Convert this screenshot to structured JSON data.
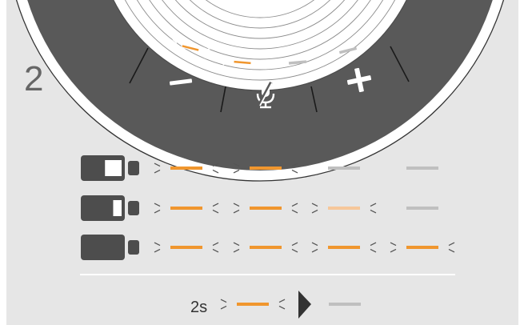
{
  "step_number": "2",
  "buttons": [
    {
      "name": "volume-down",
      "icon": "minus-icon"
    },
    {
      "name": "mute",
      "icon": "microphone-muted-icon"
    },
    {
      "name": "volume-up",
      "icon": "plus-icon"
    }
  ],
  "device_leds": [
    {
      "state": "blinking",
      "color": "#F0962E"
    },
    {
      "state": "blinking",
      "color": "#F0962E"
    },
    {
      "state": "off",
      "color": "#BFBFBF"
    },
    {
      "state": "off",
      "color": "#BFBFBF"
    }
  ],
  "battery_rows": [
    {
      "battery_icon": "battery-low-icon",
      "level": 0.33,
      "leds": [
        {
          "state": "blinking",
          "color": "#F0962E"
        },
        {
          "state": "blinking",
          "color": "#F0962E"
        },
        {
          "state": "off",
          "color": "#BFBFBF"
        },
        {
          "state": "off",
          "color": "#BFBFBF"
        }
      ]
    },
    {
      "battery_icon": "battery-medium-icon",
      "level": 0.66,
      "leds": [
        {
          "state": "blinking",
          "color": "#F0962E"
        },
        {
          "state": "blinking",
          "color": "#F0962E"
        },
        {
          "state": "blinking",
          "color": "#F6C79A"
        },
        {
          "state": "off",
          "color": "#BFBFBF"
        }
      ]
    },
    {
      "battery_icon": "battery-full-icon",
      "level": 1.0,
      "leds": [
        {
          "state": "blinking",
          "color": "#F0962E"
        },
        {
          "state": "blinking",
          "color": "#F0962E"
        },
        {
          "state": "blinking",
          "color": "#F0962E"
        },
        {
          "state": "blinking",
          "color": "#F0962E"
        }
      ]
    }
  ],
  "legend": {
    "duration": "2s",
    "from": {
      "state": "blinking",
      "color": "#F0962E"
    },
    "to": {
      "state": "off",
      "color": "#BFBFBF"
    },
    "arrow_icon": "arrow-right-icon"
  },
  "colors": {
    "background": "#E6E6E6",
    "ring": "#595959",
    "dark": "#4D4D4D",
    "led_on": "#F0962E",
    "led_off": "#BFBFBF"
  }
}
